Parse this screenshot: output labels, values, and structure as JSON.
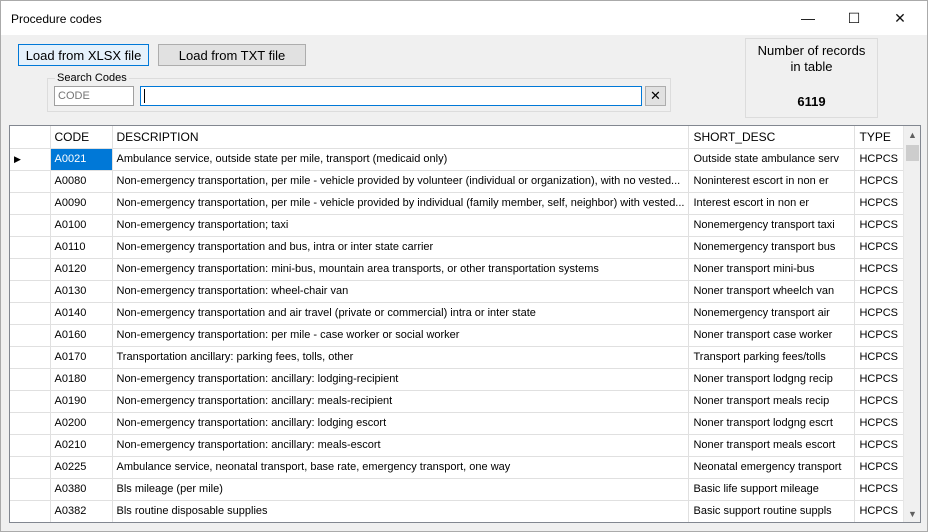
{
  "window": {
    "title": "Procedure codes"
  },
  "titlebar": {
    "min_glyph": "—",
    "max_glyph": "☐",
    "close_glyph": "✕"
  },
  "toolbar": {
    "load_xlsx_label": "Load from XLSX file",
    "load_txt_label": "Load from TXT file"
  },
  "search": {
    "group_label": "Search Codes",
    "code_placeholder": "CODE",
    "query_value": "",
    "clear_label": "✕"
  },
  "records": {
    "label_line1": "Number of records",
    "label_line2": "in table",
    "count": "6119"
  },
  "grid": {
    "columns": [
      "CODE",
      "DESCRIPTION",
      "SHORT_DESC",
      "TYPE"
    ],
    "current_row_index": 0,
    "rows": [
      {
        "code": "A0021",
        "description": "Ambulance service, outside state per mile, transport (medicaid only)",
        "short_desc": "Outside state ambulance serv",
        "type": "HCPCS"
      },
      {
        "code": "A0080",
        "description": "Non-emergency transportation, per mile - vehicle provided by volunteer (individual or organization), with no vested...",
        "short_desc": "Noninterest escort in non er",
        "type": "HCPCS"
      },
      {
        "code": "A0090",
        "description": "Non-emergency transportation, per mile - vehicle provided by individual (family member, self, neighbor) with vested...",
        "short_desc": "Interest escort in non er",
        "type": "HCPCS"
      },
      {
        "code": "A0100",
        "description": "Non-emergency transportation; taxi",
        "short_desc": "Nonemergency transport taxi",
        "type": "HCPCS"
      },
      {
        "code": "A0110",
        "description": "Non-emergency transportation and bus, intra or inter state carrier",
        "short_desc": "Nonemergency transport bus",
        "type": "HCPCS"
      },
      {
        "code": "A0120",
        "description": "Non-emergency transportation: mini-bus, mountain area transports, or other  transportation systems",
        "short_desc": "Noner transport mini-bus",
        "type": "HCPCS"
      },
      {
        "code": "A0130",
        "description": "Non-emergency transportation: wheel-chair van",
        "short_desc": "Noner transport wheelch van",
        "type": "HCPCS"
      },
      {
        "code": "A0140",
        "description": "Non-emergency transportation and air travel (private or commercial) intra or inter state",
        "short_desc": "Nonemergency transport air",
        "type": "HCPCS"
      },
      {
        "code": "A0160",
        "description": "Non-emergency transportation: per mile - case worker or social worker",
        "short_desc": "Noner transport case worker",
        "type": "HCPCS"
      },
      {
        "code": "A0170",
        "description": "Transportation ancillary:  parking fees, tolls, other",
        "short_desc": "Transport parking fees/tolls",
        "type": "HCPCS"
      },
      {
        "code": "A0180",
        "description": "Non-emergency transportation: ancillary:  lodging-recipient",
        "short_desc": "Noner transport lodgng recip",
        "type": "HCPCS"
      },
      {
        "code": "A0190",
        "description": "Non-emergency transportation: ancillary:  meals-recipient",
        "short_desc": "Noner transport meals recip",
        "type": "HCPCS"
      },
      {
        "code": "A0200",
        "description": "Non-emergency transportation: ancillary:  lodging escort",
        "short_desc": "Noner transport lodgng escrt",
        "type": "HCPCS"
      },
      {
        "code": "A0210",
        "description": "Non-emergency transportation: ancillary:  meals-escort",
        "short_desc": "Noner transport meals escort",
        "type": "HCPCS"
      },
      {
        "code": "A0225",
        "description": "Ambulance service, neonatal transport, base rate, emergency transport, one way",
        "short_desc": "Neonatal emergency transport",
        "type": "HCPCS"
      },
      {
        "code": "A0380",
        "description": "Bls mileage (per mile)",
        "short_desc": "Basic life support mileage",
        "type": "HCPCS"
      },
      {
        "code": "A0382",
        "description": "Bls routine disposable supplies",
        "short_desc": "Basic support routine suppls",
        "type": "HCPCS"
      }
    ]
  },
  "scrollbar": {
    "up_glyph": "▲",
    "down_glyph": "▼"
  },
  "colors": {
    "selection": "#0078d7",
    "grid_background": "#ababab"
  }
}
